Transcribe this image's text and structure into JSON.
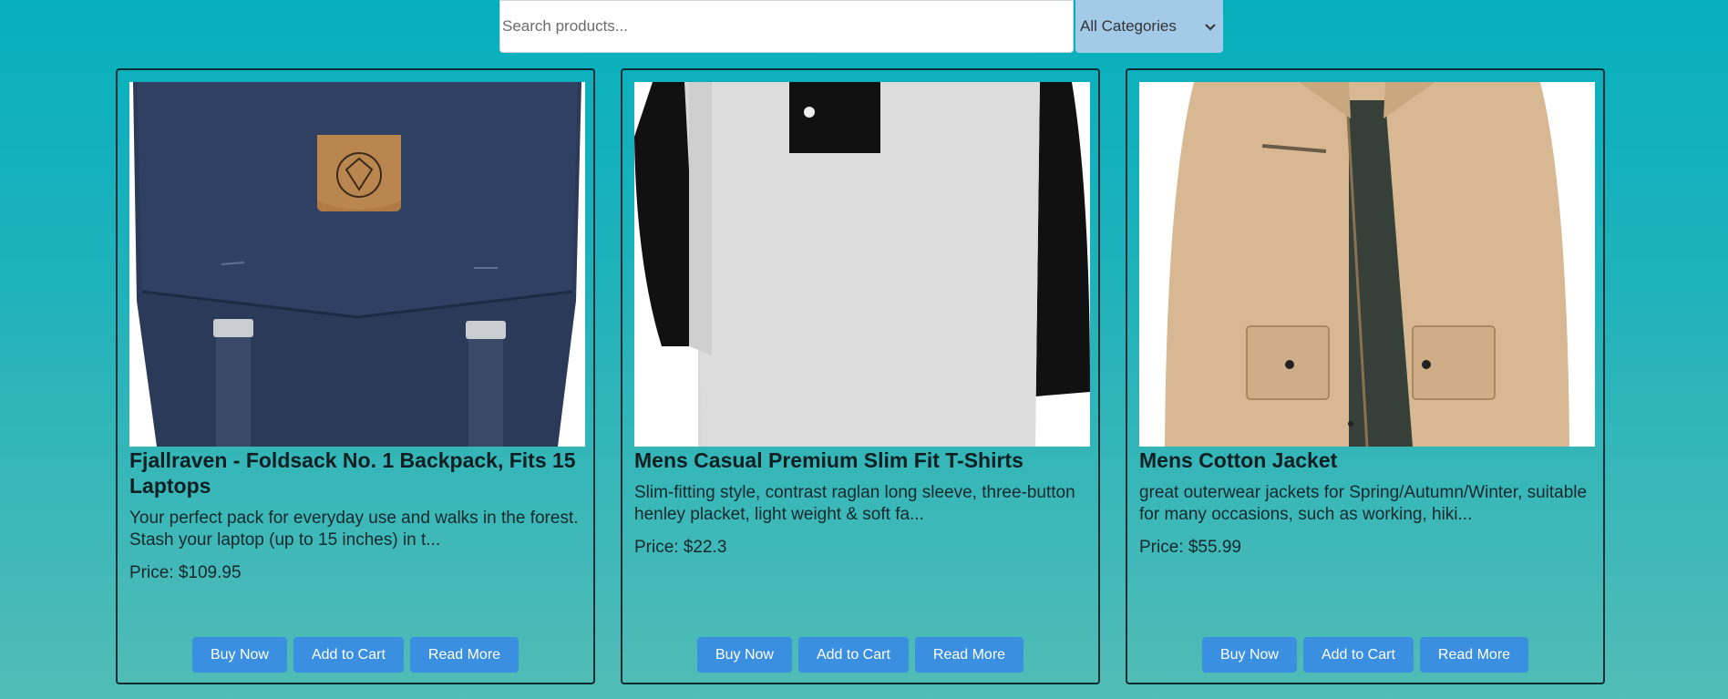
{
  "search": {
    "placeholder": "Search products...",
    "value": ""
  },
  "category": {
    "selected": "All Categories"
  },
  "products": [
    {
      "title": "Fjallraven - Foldsack No. 1 Backpack, Fits 15 Laptops",
      "description": "Your perfect pack for everyday use and walks in the forest. Stash your laptop (up to 15 inches) in t...",
      "price": "Price: $109.95",
      "buttons": [
        "Buy Now",
        "Add to Cart",
        "Read More"
      ]
    },
    {
      "title": "Mens Casual Premium Slim Fit T-Shirts",
      "description": "Slim-fitting style, contrast raglan long sleeve, three-button henley placket, light weight & soft fa...",
      "price": "Price: $22.3",
      "buttons": [
        "Buy Now",
        "Add to Cart",
        "Read More"
      ]
    },
    {
      "title": "Mens Cotton Jacket",
      "description": "great outerwear jackets for Spring/Autumn/Winter, suitable for many occasions, such as working, hiki...",
      "price": "Price: $55.99",
      "buttons": [
        "Buy Now",
        "Add to Cart",
        "Read More"
      ]
    }
  ]
}
